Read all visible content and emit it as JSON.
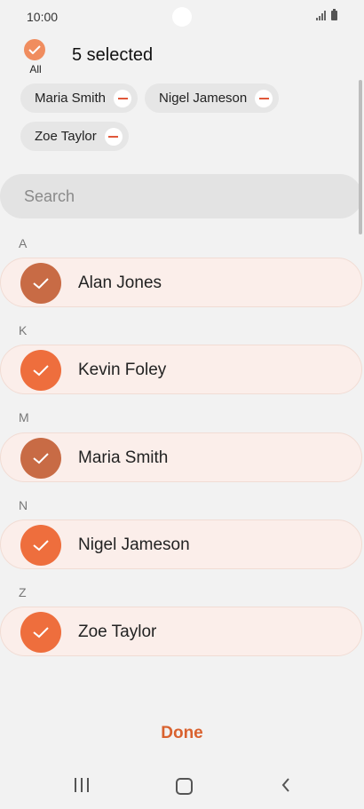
{
  "status_bar": {
    "time": "10:00"
  },
  "header": {
    "all_label": "All",
    "selected_count": "5 selected"
  },
  "chips": [
    {
      "name": "Maria Smith"
    },
    {
      "name": "Nigel Jameson"
    },
    {
      "name": "Zoe Taylor"
    }
  ],
  "search": {
    "placeholder": "Search"
  },
  "sections": [
    {
      "letter": "A",
      "contact": "Alan Jones"
    },
    {
      "letter": "K",
      "contact": "Kevin Foley"
    },
    {
      "letter": "M",
      "contact": "Maria Smith"
    },
    {
      "letter": "N",
      "contact": "Nigel Jameson"
    },
    {
      "letter": "Z",
      "contact": "Zoe Taylor"
    }
  ],
  "footer": {
    "done_label": "Done"
  },
  "colors": {
    "accent": "#ee6e3d",
    "done_text": "#d9622f",
    "item_bg": "#fbeeea"
  }
}
